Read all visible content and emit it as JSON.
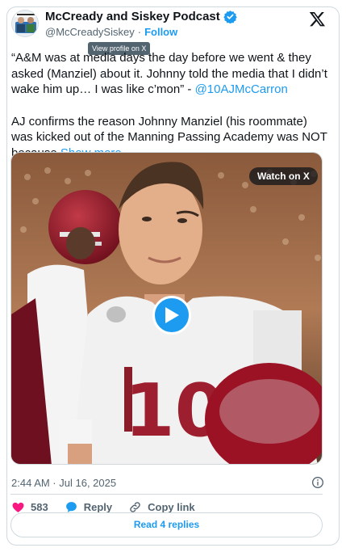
{
  "author": {
    "display_name": "McCready and Siskey Podcast",
    "handle": "@McCreadySiskey",
    "separator": "·",
    "follow_label": "Follow",
    "tooltip": "View profile on X"
  },
  "tweet": {
    "paragraph1_text": "“A&M was at media days the day before we went & they asked (Manziel) about it. Johnny told the media that I didn’t wake him up… I was like c’mon” - ",
    "paragraph1_mention": "@10AJMcCarron",
    "paragraph2_text": "AJ confirms the reason Johnny Manziel (his roommate) was kicked out of the Manning Passing Academy was NOT because ",
    "show_more": "Show more"
  },
  "media": {
    "watch_label": "Watch on X",
    "jersey_number": "10"
  },
  "meta": {
    "timestamp": "2:44 AM · Jul 16, 2025"
  },
  "actions": {
    "like_count": "583",
    "reply_label": "Reply",
    "copy_link_label": "Copy link"
  },
  "footer": {
    "read_replies_label": "Read 4 replies"
  },
  "colors": {
    "accent": "#1d9bf0",
    "like": "#f91880",
    "secondary_text": "#536471"
  }
}
